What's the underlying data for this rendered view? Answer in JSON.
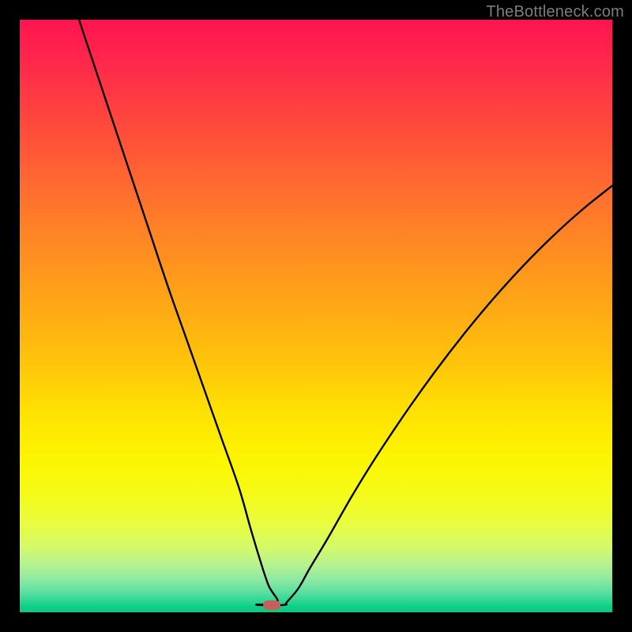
{
  "watermark": "TheBottleneck.com",
  "marker": {
    "color": "#c1605c",
    "x_pct": 42.5,
    "y_pct": 98.8
  },
  "chart_data": {
    "type": "line",
    "title": "",
    "xlabel": "",
    "ylabel": "",
    "xlim": [
      0,
      100
    ],
    "ylim": [
      0,
      100
    ],
    "grid": false,
    "legend": false,
    "background_gradient": {
      "direction": "vertical",
      "stops": [
        {
          "pos": 0.0,
          "color": "#ff1450"
        },
        {
          "pos": 0.5,
          "color": "#ffb810"
        },
        {
          "pos": 0.76,
          "color": "#fbf800"
        },
        {
          "pos": 1.0,
          "color": "#08cc80"
        }
      ]
    },
    "series": [
      {
        "name": "left-branch",
        "color": "#000000",
        "x": [
          10.0,
          13.0,
          16.0,
          19.0,
          22.0,
          25.0,
          28.0,
          31.0,
          34.0,
          37.0,
          39.0,
          40.5,
          42.0,
          43.5
        ],
        "y": [
          100.0,
          91.0,
          82.0,
          73.0,
          64.0,
          55.0,
          46.5,
          38.0,
          29.5,
          21.0,
          14.0,
          9.0,
          4.5,
          1.6
        ]
      },
      {
        "name": "valley-floor",
        "color": "#000000",
        "x": [
          40.0,
          41.0,
          42.0,
          43.0,
          44.0,
          45.0
        ],
        "y": [
          1.3,
          1.2,
          1.2,
          1.2,
          1.2,
          1.3
        ]
      },
      {
        "name": "right-branch",
        "color": "#000000",
        "x": [
          45.0,
          47.0,
          49.0,
          52.0,
          56.0,
          60.0,
          65.0,
          70.0,
          75.0,
          80.0,
          85.0,
          90.0,
          95.0,
          100.0
        ],
        "y": [
          1.6,
          4.0,
          7.5,
          12.5,
          19.5,
          26.0,
          33.5,
          40.5,
          47.0,
          53.0,
          58.5,
          63.5,
          68.0,
          72.0
        ]
      }
    ],
    "marker_point": {
      "x": 42.5,
      "y": 1.2,
      "color": "#c1605c"
    }
  }
}
